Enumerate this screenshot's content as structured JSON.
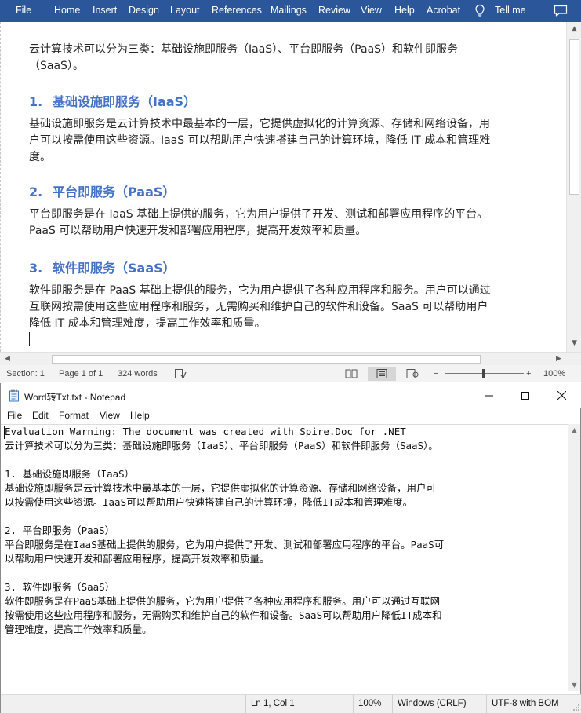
{
  "word": {
    "ribbon_tabs": [
      "File",
      "Home",
      "Insert",
      "Design",
      "Layout",
      "References",
      "Mailings",
      "Review",
      "View",
      "Help",
      "Acrobat"
    ],
    "tell_me": "Tell me",
    "accent_color": "#2b579a",
    "document": {
      "intro_line1": "云计算技术可以分为三类：基础设施即服务（IaaS）、平台即服务（PaaS）和软件即服务",
      "intro_line2": "（SaaS）。",
      "sections": [
        {
          "num": "1.",
          "heading": "基础设施即服务（IaaS）",
          "lines": [
            "基础设施即服务是云计算技术中最基本的一层，它提供虚拟化的计算资源、存储和网络设备，用",
            "户可以按需使用这些资源。IaaS 可以帮助用户快速搭建自己的计算环境，降低 IT 成本和管理难",
            "度。"
          ]
        },
        {
          "num": "2.",
          "heading": "平台即服务（PaaS）",
          "lines": [
            "平台即服务是在 IaaS 基础上提供的服务，它为用户提供了开发、测试和部署应用程序的平台。",
            "PaaS 可以帮助用户快速开发和部署应用程序，提高开发效率和质量。"
          ]
        },
        {
          "num": "3.",
          "heading": "软件即服务（SaaS）",
          "lines": [
            "软件即服务是在 PaaS 基础上提供的服务，它为用户提供了各种应用程序和服务。用户可以通过",
            "互联网按需使用这些应用程序和服务，无需购买和维护自己的软件和设备。SaaS 可以帮助用户",
            "降低 IT 成本和管理难度，提高工作效率和质量。"
          ]
        }
      ],
      "heading_color": "#4472c4"
    },
    "status": {
      "section": "Section: 1",
      "page": "Page 1 of 1",
      "words": "324 words",
      "zoom_minus": "−",
      "zoom_plus": "+",
      "zoom": "100%"
    }
  },
  "notepad": {
    "title": "Word转Txt.txt - Notepad",
    "menu": [
      "File",
      "Edit",
      "Format",
      "View",
      "Help"
    ],
    "lines": [
      "Evaluation Warning: The document was created with Spire.Doc for .NET",
      "云计算技术可以分为三类：基础设施即服务（IaaS）、平台即服务（PaaS）和软件即服务（SaaS）。",
      "",
      "1. 基础设施即服务（IaaS）",
      "基础设施即服务是云计算技术中最基本的一层，它提供虚拟化的计算资源、存储和网络设备，用户可",
      "以按需使用这些资源。IaaS可以帮助用户快速搭建自己的计算环境，降低IT成本和管理难度。",
      "",
      "2. 平台即服务（PaaS）",
      "平台即服务是在IaaS基础上提供的服务，它为用户提供了开发、测试和部署应用程序的平台。PaaS可",
      "以帮助用户快速开发和部署应用程序，提高开发效率和质量。",
      "",
      "3. 软件即服务（SaaS）",
      "软件即服务是在PaaS基础上提供的服务，它为用户提供了各种应用程序和服务。用户可以通过互联网",
      "按需使用这些应用程序和服务，无需购买和维护自己的软件和设备。SaaS可以帮助用户降低IT成本和",
      "管理难度，提高工作效率和质量。"
    ],
    "status": {
      "position": "Ln 1, Col 1",
      "zoom": "100%",
      "line_ending": "Windows (CRLF)",
      "encoding": "UTF-8 with BOM"
    }
  }
}
